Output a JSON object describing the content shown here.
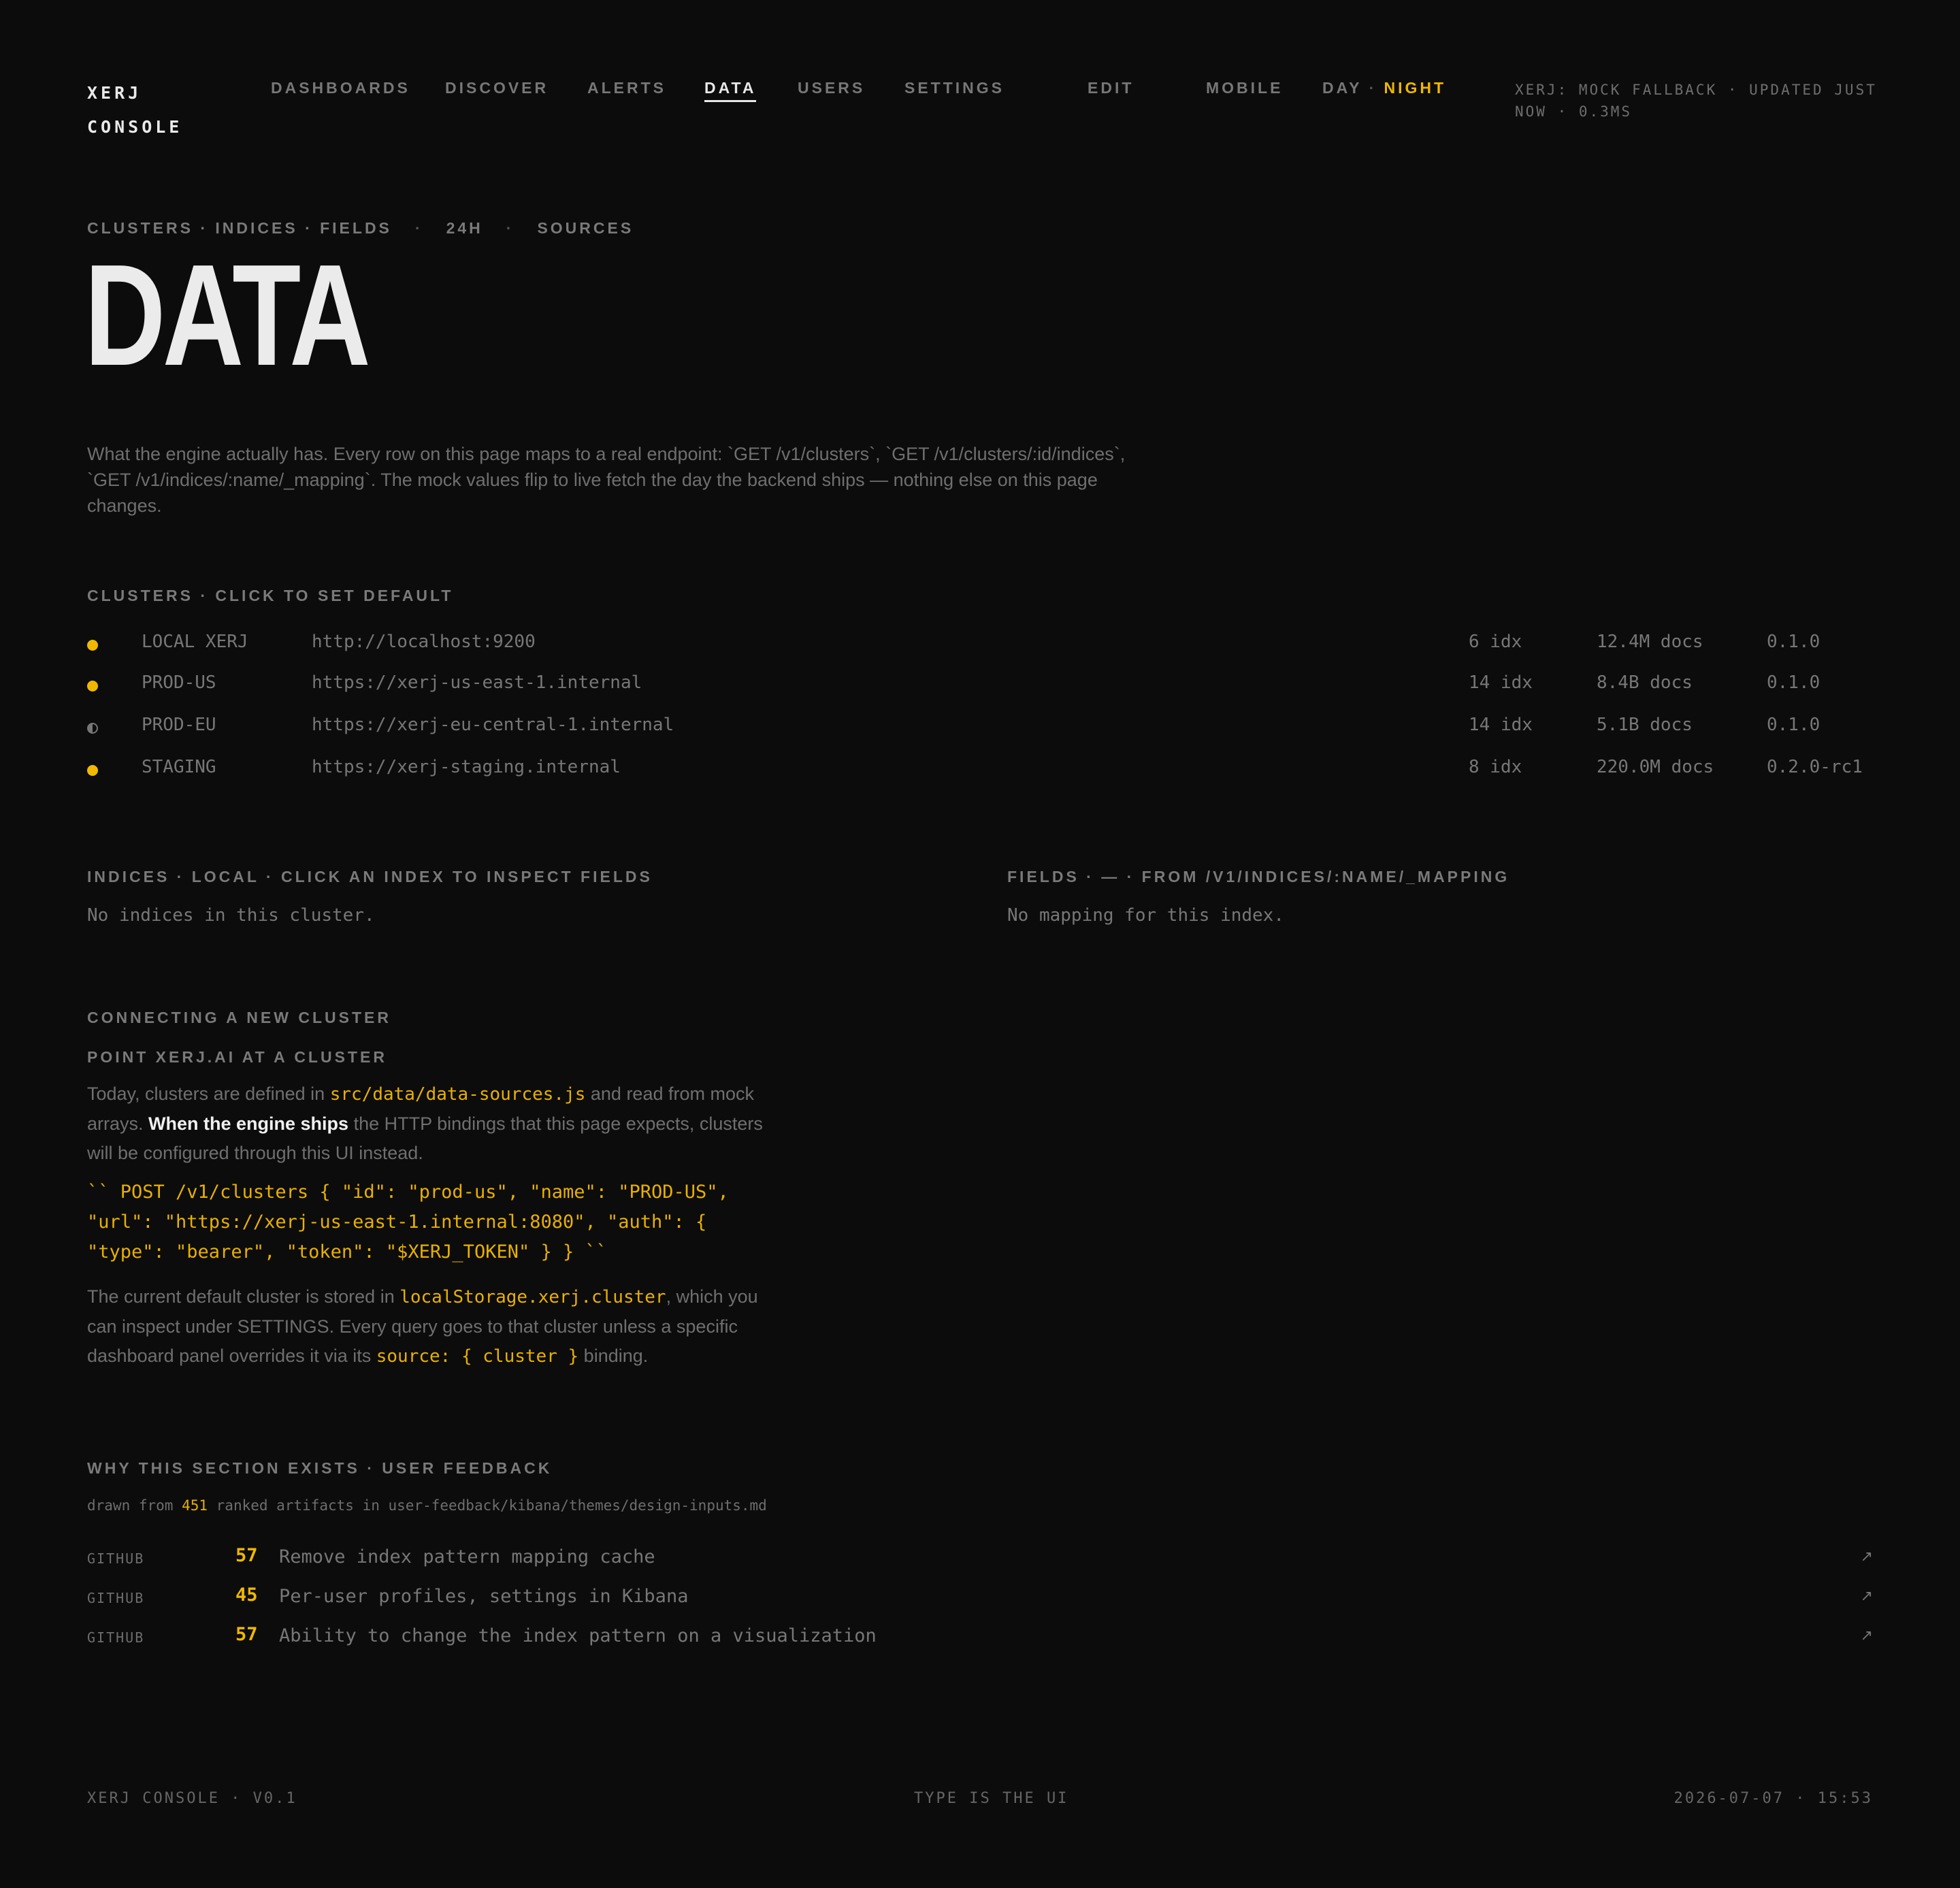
{
  "header": {
    "brand_line1": "XERJ",
    "brand_line2": "CONSOLE",
    "nav": [
      "DASHBOARDS",
      "DISCOVER",
      "ALERTS",
      "DATA",
      "USERS",
      "SETTINGS"
    ],
    "active_nav": "DATA",
    "edit": "EDIT",
    "mobile": "MOBILE",
    "day": "DAY",
    "theme_sep": "·",
    "night": "NIGHT",
    "status": "XERJ: MOCK FALLBACK · UPDATED JUST NOW · 0.3MS"
  },
  "hero": {
    "crumb_1": "CLUSTERS · INDICES · FIELDS",
    "crumb_sep": "·",
    "crumb_2": "24H",
    "crumb_3": "SOURCES",
    "title": "DATA",
    "intro": "What the engine actually has. Every row on this page maps to a real endpoint: `GET /v1/clusters`, `GET /v1/clusters/:id/indices`, `GET /v1/indices/:name/_mapping`. The mock values flip to live fetch the day the backend ships — nothing else on this page changes."
  },
  "clusters": {
    "label": "CLUSTERS · CLICK TO SET DEFAULT",
    "rows": [
      {
        "status": "active",
        "name": "LOCAL XERJ",
        "url": "http://localhost:9200",
        "indices": "6 idx",
        "docs": "12.4M docs",
        "version": "0.1.0"
      },
      {
        "status": "active",
        "name": "PROD-US",
        "url": "https://xerj-us-east-1.internal",
        "indices": "14 idx",
        "docs": "8.4B docs",
        "version": "0.1.0"
      },
      {
        "status": "degraded",
        "name": "PROD-EU",
        "url": "https://xerj-eu-central-1.internal",
        "indices": "14 idx",
        "docs": "5.1B docs",
        "version": "0.1.0"
      },
      {
        "status": "active",
        "name": "STAGING",
        "url": "https://xerj-staging.internal",
        "indices": "8 idx",
        "docs": "220.0M docs",
        "version": "0.2.0-rc1"
      }
    ]
  },
  "indices": {
    "label": "INDICES · LOCAL · CLICK AN INDEX TO INSPECT FIELDS",
    "empty": "No indices in this cluster."
  },
  "fields": {
    "label": "FIELDS · — · FROM /V1/INDICES/:NAME/_MAPPING",
    "empty": "No mapping for this index."
  },
  "connect": {
    "label": "CONNECTING A NEW CLUSTER",
    "sublabel": "POINT XERJ.AI AT A CLUSTER",
    "p1_a": "Today, clusters are defined in ",
    "p1_code": "src/data/data-sources.js",
    "p1_b": " and read from mock arrays. ",
    "p1_strong": "When the engine ships",
    "p1_c": " the HTTP bindings that this page expects, clusters will be configured through this UI instead.",
    "code_block": "`` POST /v1/clusters { \"id\": \"prod-us\", \"name\": \"PROD-US\", \"url\": \"https://xerj-us-east-1.internal:8080\", \"auth\": { \"type\": \"bearer\", \"token\": \"$XERJ_TOKEN\" } } ``",
    "p2_a": "The current default cluster is stored in ",
    "p2_code1": "localStorage.xerj.cluster",
    "p2_b": ", which you can inspect under SETTINGS. Every query goes to that cluster unless a specific dashboard panel overrides it via its ",
    "p2_code2": "source: { cluster }",
    "p2_c": " binding."
  },
  "feedback": {
    "label": "WHY THIS SECTION EXISTS · USER FEEDBACK",
    "sub_a": "drawn from ",
    "sub_count": "451",
    "sub_b": " ranked artifacts in user-feedback/kibana/themes/design-inputs.md",
    "rows": [
      {
        "source": "GITHUB",
        "score": "57",
        "text": "Remove index pattern mapping cache",
        "arrow": "↗"
      },
      {
        "source": "GITHUB",
        "score": "45",
        "text": "Per-user profiles, settings in Kibana",
        "arrow": "↗"
      },
      {
        "source": "GITHUB",
        "score": "57",
        "text": "Ability to change the index pattern on a visualization",
        "arrow": "↗"
      }
    ]
  },
  "footer": {
    "left": "XERJ CONSOLE · V0.1",
    "center": "TYPE IS THE UI",
    "right": "2026-07-07 · 15:53"
  },
  "colors": {
    "background": "#0c0c0c",
    "accent": "#f0b800",
    "text_primary": "#ebebeb",
    "text_muted": "#777777"
  }
}
